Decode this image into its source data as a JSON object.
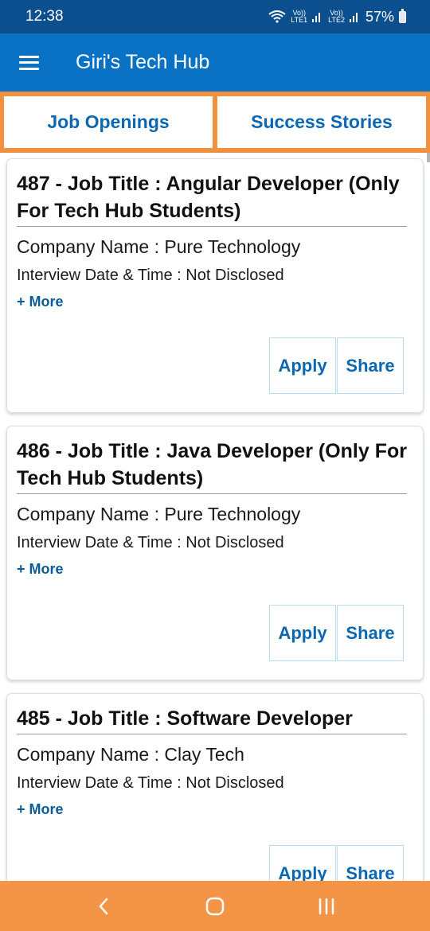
{
  "status_bar": {
    "time": "12:38",
    "sim1_label_top": "Vo))",
    "sim1_label_bottom": "LTE1",
    "sim2_label_top": "Vo))",
    "sim2_label_bottom": "LTE2",
    "battery": "57%",
    "icons": [
      "wifi-icon",
      "signal-icon",
      "battery-icon"
    ]
  },
  "app_bar": {
    "title": "Giri's Tech Hub",
    "menu_icon": "hamburger-menu-icon"
  },
  "tabs": [
    {
      "label": "Job Openings"
    },
    {
      "label": "Success Stories"
    }
  ],
  "colors": {
    "status_bar": "#0b4f8f",
    "app_bar": "#0a72c5",
    "accent_orange": "#f1913f",
    "link_blue": "#0b67b2"
  },
  "jobs": [
    {
      "title": "487 - Job Title : Angular Developer (Only For Tech Hub Students)",
      "company": "Company Name :  Pure Technology",
      "interview": "Interview Date & Time : Not Disclosed",
      "more": "+ More",
      "apply": "Apply",
      "share": "Share"
    },
    {
      "title": "486 - Job Title : Java Developer (Only For Tech Hub Students)",
      "company": "Company Name :  Pure Technology",
      "interview": "Interview Date & Time : Not Disclosed",
      "more": "+ More",
      "apply": "Apply",
      "share": "Share"
    },
    {
      "title": "485 - Job Title : Software Developer",
      "company": "Company Name : Clay Tech",
      "interview": "Interview Date & Time : Not Disclosed",
      "more": "+ More",
      "apply": "Apply",
      "share": "Share"
    }
  ],
  "nav_bar": {
    "buttons": [
      "back-icon",
      "home-icon",
      "recents-icon"
    ]
  }
}
